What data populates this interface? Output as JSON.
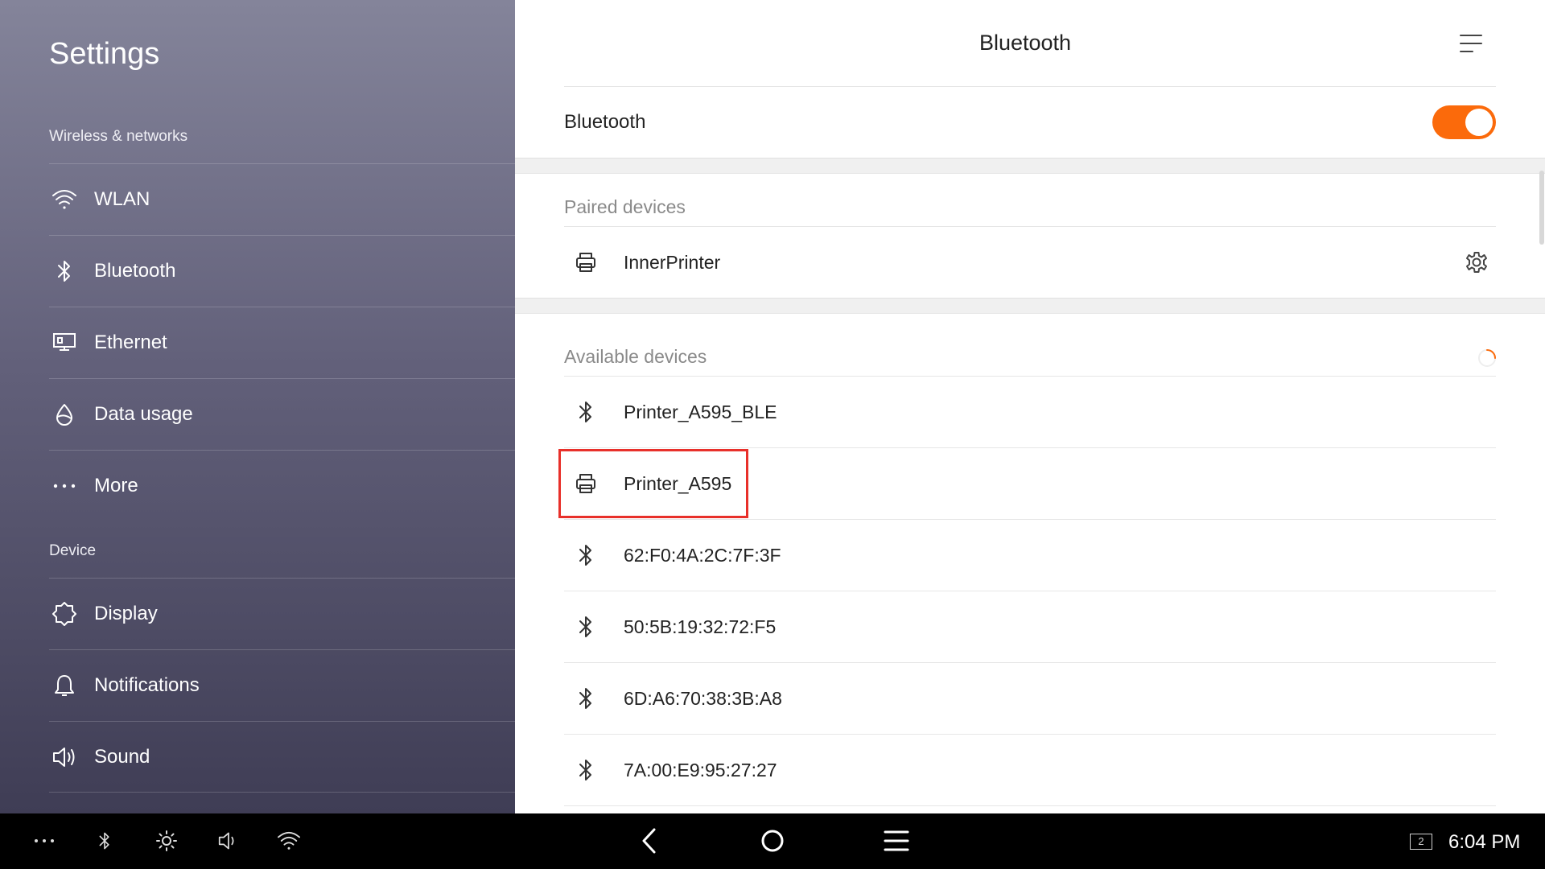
{
  "sidebar": {
    "title": "Settings",
    "sections": [
      {
        "label": "Wireless & networks"
      },
      {
        "label": "Device"
      }
    ],
    "items": [
      {
        "label": "WLAN",
        "icon": "wifi-icon"
      },
      {
        "label": "Bluetooth",
        "icon": "bluetooth-icon"
      },
      {
        "label": "Ethernet",
        "icon": "ethernet-icon"
      },
      {
        "label": "Data usage",
        "icon": "data-usage-icon"
      },
      {
        "label": "More",
        "icon": "more-dots-icon"
      },
      {
        "label": "Display",
        "icon": "display-brightness-icon"
      },
      {
        "label": "Notifications",
        "icon": "bell-icon"
      },
      {
        "label": "Sound",
        "icon": "speaker-icon"
      }
    ]
  },
  "main": {
    "title": "Bluetooth",
    "bluetooth_toggle": {
      "label": "Bluetooth",
      "state": "on"
    },
    "paired": {
      "label": "Paired devices",
      "devices": [
        {
          "name": "InnerPrinter",
          "icon": "printer-icon"
        }
      ]
    },
    "available": {
      "label": "Available devices",
      "devices": [
        {
          "name": "Printer_A595_BLE",
          "icon": "bluetooth-icon"
        },
        {
          "name": "Printer_A595",
          "icon": "printer-icon",
          "highlighted": true
        },
        {
          "name": "62:F0:4A:2C:7F:3F",
          "icon": "bluetooth-icon"
        },
        {
          "name": "50:5B:19:32:72:F5",
          "icon": "bluetooth-icon"
        },
        {
          "name": "6D:A6:70:38:3B:A8",
          "icon": "bluetooth-icon"
        },
        {
          "name": "7A:00:E9:95:27:27",
          "icon": "bluetooth-icon"
        }
      ]
    }
  },
  "navbar": {
    "clock": "6:04 PM",
    "screen_badge": "2"
  },
  "colors": {
    "accent": "#fb6a0b",
    "highlight": "#e8302a",
    "sidebar_top": "#84849a",
    "sidebar_bottom": "#3f3d55",
    "navbar": "#000000"
  }
}
